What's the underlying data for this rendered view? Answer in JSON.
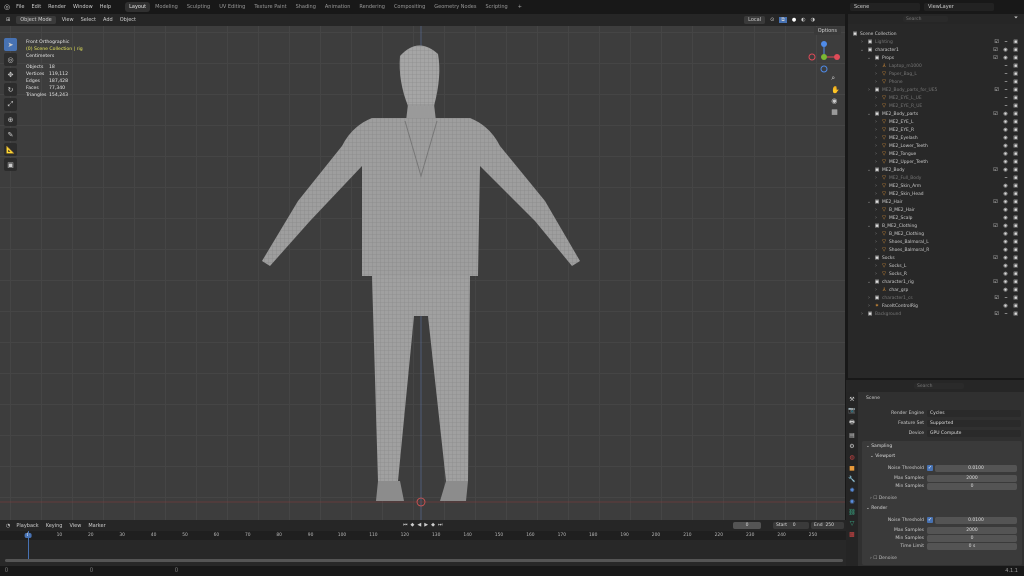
{
  "menu": [
    "File",
    "Edit",
    "Render",
    "Window",
    "Help"
  ],
  "workspaces": [
    "Layout",
    "Modeling",
    "Sculpting",
    "UV Editing",
    "Texture Paint",
    "Shading",
    "Animation",
    "Rendering",
    "Compositing",
    "Geometry Nodes",
    "Scripting"
  ],
  "active_workspace": "Layout",
  "scene": "Scene",
  "view_layer": "ViewLayer",
  "viewport": {
    "mode": "Object Mode",
    "menus": [
      "View",
      "Select",
      "Add",
      "Object"
    ],
    "transform_orientation": "Local",
    "options": "Options",
    "view_name": "Front Orthographic",
    "collection": "(0) Scene Collection | rig",
    "units": "Centimeters",
    "stats": [
      [
        "Objects",
        "18"
      ],
      [
        "Vertices",
        "119,112"
      ],
      [
        "Edges",
        "187,428"
      ],
      [
        "Faces",
        "77,340"
      ],
      [
        "Triangles",
        "154,243"
      ]
    ]
  },
  "outliner": {
    "search_placeholder": "Search",
    "rows": [
      {
        "label": "Scene Collection",
        "level": 0,
        "type": "collection"
      },
      {
        "label": "Lighting",
        "level": 1,
        "type": "collection",
        "dim": true
      },
      {
        "label": "character1",
        "level": 1,
        "type": "collection"
      },
      {
        "label": "Props",
        "level": 2,
        "type": "collection"
      },
      {
        "label": "Laptop_m1000",
        "level": 3,
        "type": "empty",
        "dim": true
      },
      {
        "label": "Paper_Bag_L",
        "level": 3,
        "type": "mesh",
        "dim": true
      },
      {
        "label": "Phone",
        "level": 3,
        "type": "mesh",
        "dim": true
      },
      {
        "label": "ME2_Body_parts_for_UE5",
        "level": 2,
        "type": "collection",
        "dim": true
      },
      {
        "label": "ME2_EYE_L_UE",
        "level": 3,
        "type": "mesh",
        "dim": true
      },
      {
        "label": "ME2_EYE_R_UE",
        "level": 3,
        "type": "mesh",
        "dim": true
      },
      {
        "label": "ME2_Body_parts",
        "level": 2,
        "type": "collection"
      },
      {
        "label": "ME2_EYE_L",
        "level": 3,
        "type": "mesh"
      },
      {
        "label": "ME2_EYE_R",
        "level": 3,
        "type": "mesh"
      },
      {
        "label": "ME2_Eyelash",
        "level": 3,
        "type": "mesh"
      },
      {
        "label": "ME2_Lower_Teeth",
        "level": 3,
        "type": "mesh"
      },
      {
        "label": "ME2_Tongue",
        "level": 3,
        "type": "mesh"
      },
      {
        "label": "ME2_Upper_Teeth",
        "level": 3,
        "type": "mesh"
      },
      {
        "label": "ME2_Body",
        "level": 2,
        "type": "collection"
      },
      {
        "label": "ME2_Full_Body",
        "level": 3,
        "type": "mesh",
        "dim": true
      },
      {
        "label": "ME2_Skin_Arm",
        "level": 3,
        "type": "mesh"
      },
      {
        "label": "ME2_Skin_Head",
        "level": 3,
        "type": "mesh"
      },
      {
        "label": "ME2_Hair",
        "level": 2,
        "type": "collection"
      },
      {
        "label": "B_ME2_Hair",
        "level": 3,
        "type": "mesh"
      },
      {
        "label": "ME2_Scalp",
        "level": 3,
        "type": "mesh"
      },
      {
        "label": "B_ME2_Clothing",
        "level": 2,
        "type": "collection"
      },
      {
        "label": "B_ME2_Clothing",
        "level": 3,
        "type": "mesh"
      },
      {
        "label": "Shoes_Balmoral_L",
        "level": 3,
        "type": "mesh"
      },
      {
        "label": "Shoes_Balmoral_R",
        "level": 3,
        "type": "mesh"
      },
      {
        "label": "Socks",
        "level": 2,
        "type": "collection"
      },
      {
        "label": "Socks_L",
        "level": 3,
        "type": "mesh"
      },
      {
        "label": "Socks_R",
        "level": 3,
        "type": "mesh"
      },
      {
        "label": "character1_rig",
        "level": 2,
        "type": "collection"
      },
      {
        "label": "char_grp",
        "level": 3,
        "type": "empty"
      },
      {
        "label": "character1_cs",
        "level": 2,
        "type": "collection",
        "dim": true
      },
      {
        "label": "FaceItControlRig",
        "level": 2,
        "type": "armature"
      },
      {
        "label": "Background",
        "level": 1,
        "type": "collection",
        "dim": true
      }
    ]
  },
  "properties": {
    "search_placeholder": "Search",
    "context": "Scene",
    "render_engine": {
      "label": "Render Engine",
      "value": "Cycles"
    },
    "feature_set": {
      "label": "Feature Set",
      "value": "Supported"
    },
    "device": {
      "label": "Device",
      "value": "GPU Compute"
    },
    "sampling": "Sampling",
    "viewport": {
      "title": "Viewport",
      "noise_threshold_label": "Noise Threshold",
      "noise_threshold": "0.0100",
      "max_samples_label": "Max Samples",
      "max_samples": "2000",
      "min_samples_label": "Min Samples",
      "min_samples": "0",
      "denoise": "Denoise"
    },
    "render": {
      "title": "Render",
      "noise_threshold_label": "Noise Threshold",
      "noise_threshold": "0.0100",
      "max_samples_label": "Max Samples",
      "max_samples": "2000",
      "min_samples_label": "Min Samples",
      "min_samples": "0",
      "time_limit_label": "Time Limit",
      "time_limit": "0 s",
      "denoise": "Denoise"
    }
  },
  "timeline": {
    "menus": [
      "Playback",
      "Keying",
      "View",
      "Marker"
    ],
    "current_frame": "0",
    "start_label": "Start",
    "start": "0",
    "end_label": "End",
    "end": "250",
    "ticks": [
      0,
      10,
      20,
      30,
      40,
      50,
      60,
      70,
      80,
      90,
      100,
      110,
      120,
      130,
      140,
      150,
      160,
      170,
      180,
      190,
      200,
      210,
      220,
      230,
      240,
      250
    ]
  },
  "version": "4.1.1"
}
